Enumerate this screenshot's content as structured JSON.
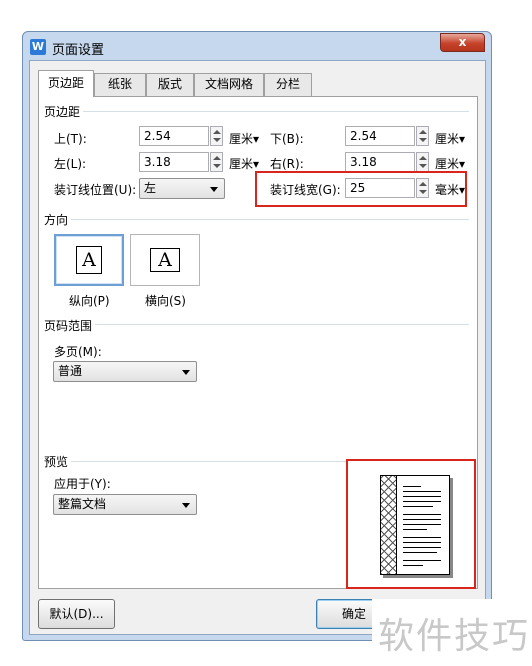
{
  "window": {
    "title": "页面设置",
    "app_icon": "W",
    "close": "x"
  },
  "tabs": [
    {
      "label": "页边距",
      "active": true
    },
    {
      "label": "纸张",
      "active": false
    },
    {
      "label": "版式",
      "active": false
    },
    {
      "label": "文档网格",
      "active": false
    },
    {
      "label": "分栏",
      "active": false
    }
  ],
  "margins": {
    "section": "页边距",
    "top": {
      "label": "上(T):",
      "value": "2.54",
      "unit": "厘米▾"
    },
    "bottom": {
      "label": "下(B):",
      "value": "2.54",
      "unit": "厘米▾"
    },
    "left": {
      "label": "左(L):",
      "value": "3.18",
      "unit": "厘米▾"
    },
    "right": {
      "label": "右(R):",
      "value": "3.18",
      "unit": "厘米▾"
    },
    "gutter_pos": {
      "label": "装订线位置(U):",
      "value": "左"
    },
    "gutter": {
      "label": "装订线宽(G):",
      "value": "25",
      "unit": "毫米▾"
    }
  },
  "orientation": {
    "section": "方向",
    "portrait": {
      "label": "纵向(P)",
      "glyph": "A",
      "selected": true
    },
    "landscape": {
      "label": "横向(S)",
      "glyph": "A",
      "selected": false
    }
  },
  "pages": {
    "section": "页码范围",
    "multi_label": "多页(M):",
    "multi_value": "普通"
  },
  "preview": {
    "section": "预览",
    "apply_label": "应用于(Y):",
    "apply_value": "整篇文档"
  },
  "buttons": {
    "default": "默认(D)...",
    "ok": "确定"
  },
  "watermark": "软件技巧",
  "colors": {
    "highlight": "#d9261c",
    "title_bar": "#c5d8ee",
    "close": "#c7432b"
  }
}
